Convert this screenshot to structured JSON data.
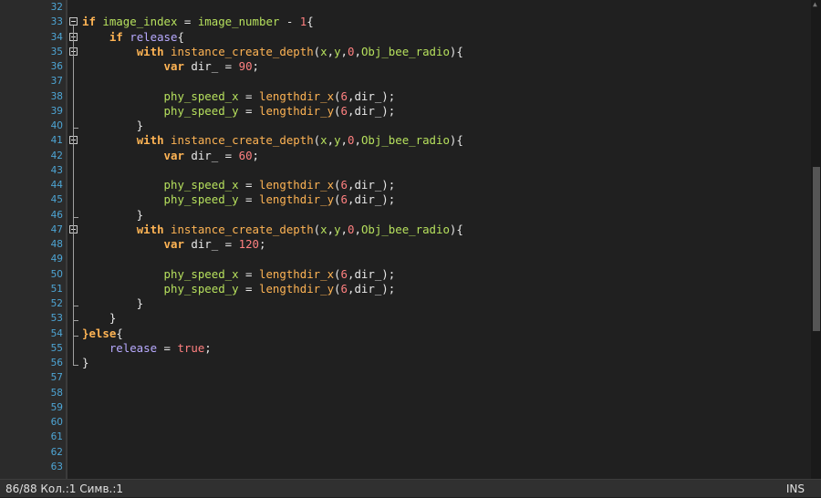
{
  "editor": {
    "line_numbers": [
      "32",
      "33",
      "34",
      "35",
      "36",
      "37",
      "38",
      "39",
      "40",
      "41",
      "42",
      "43",
      "44",
      "45",
      "46",
      "47",
      "48",
      "49",
      "50",
      "51",
      "52",
      "53",
      "54",
      "55",
      "56",
      "57",
      "58",
      "59",
      "60",
      "61",
      "62",
      "63"
    ],
    "lines": [
      {
        "no": "32",
        "tokens": []
      },
      {
        "no": "33",
        "tokens": [
          [
            "kw",
            "if"
          ],
          [
            "op",
            " "
          ],
          [
            "lf",
            "image_index"
          ],
          [
            "op",
            " = "
          ],
          [
            "lf",
            "image_number"
          ],
          [
            "op",
            " - "
          ],
          [
            "num",
            "1"
          ],
          [
            "op",
            "{"
          ]
        ]
      },
      {
        "no": "34",
        "tokens": [
          [
            "op",
            "    "
          ],
          [
            "kw",
            "if"
          ],
          [
            "op",
            " "
          ],
          [
            "var",
            "release"
          ],
          [
            "op",
            "{"
          ]
        ]
      },
      {
        "no": "35",
        "tokens": [
          [
            "op",
            "        "
          ],
          [
            "kw",
            "with"
          ],
          [
            "op",
            " "
          ],
          [
            "fn",
            "instance_create_depth"
          ],
          [
            "op",
            "("
          ],
          [
            "lf",
            "x"
          ],
          [
            "op",
            ","
          ],
          [
            "lf",
            "y"
          ],
          [
            "op",
            ","
          ],
          [
            "num",
            "0"
          ],
          [
            "op",
            ","
          ],
          [
            "lf",
            "Obj_bee_radio"
          ],
          [
            "op",
            ")"
          ],
          [
            "op",
            "{"
          ]
        ]
      },
      {
        "no": "36",
        "tokens": [
          [
            "op",
            "            "
          ],
          [
            "kw",
            "var"
          ],
          [
            "op",
            " dir_ = "
          ],
          [
            "num",
            "90"
          ],
          [
            "op",
            ";"
          ]
        ]
      },
      {
        "no": "37",
        "tokens": []
      },
      {
        "no": "38",
        "tokens": [
          [
            "op",
            "            "
          ],
          [
            "lf",
            "phy_speed_x"
          ],
          [
            "op",
            " = "
          ],
          [
            "fn",
            "lengthdir_x"
          ],
          [
            "op",
            "("
          ],
          [
            "num",
            "6"
          ],
          [
            "op",
            ",dir_);"
          ]
        ]
      },
      {
        "no": "39",
        "tokens": [
          [
            "op",
            "            "
          ],
          [
            "lf",
            "phy_speed_y"
          ],
          [
            "op",
            " = "
          ],
          [
            "fn",
            "lengthdir_y"
          ],
          [
            "op",
            "("
          ],
          [
            "num",
            "6"
          ],
          [
            "op",
            ",dir_);"
          ]
        ]
      },
      {
        "no": "40",
        "tokens": [
          [
            "op",
            "        }"
          ]
        ]
      },
      {
        "no": "41",
        "tokens": [
          [
            "op",
            "        "
          ],
          [
            "kw",
            "with"
          ],
          [
            "op",
            " "
          ],
          [
            "fn",
            "instance_create_depth"
          ],
          [
            "op",
            "("
          ],
          [
            "lf",
            "x"
          ],
          [
            "op",
            ","
          ],
          [
            "lf",
            "y"
          ],
          [
            "op",
            ","
          ],
          [
            "num",
            "0"
          ],
          [
            "op",
            ","
          ],
          [
            "lf",
            "Obj_bee_radio"
          ],
          [
            "op",
            ")"
          ],
          [
            "op",
            "{"
          ]
        ]
      },
      {
        "no": "42",
        "tokens": [
          [
            "op",
            "            "
          ],
          [
            "kw",
            "var"
          ],
          [
            "op",
            " dir_ = "
          ],
          [
            "num",
            "60"
          ],
          [
            "op",
            ";"
          ]
        ]
      },
      {
        "no": "43",
        "tokens": []
      },
      {
        "no": "44",
        "tokens": [
          [
            "op",
            "            "
          ],
          [
            "lf",
            "phy_speed_x"
          ],
          [
            "op",
            " = "
          ],
          [
            "fn",
            "lengthdir_x"
          ],
          [
            "op",
            "("
          ],
          [
            "num",
            "6"
          ],
          [
            "op",
            ",dir_);"
          ]
        ]
      },
      {
        "no": "45",
        "tokens": [
          [
            "op",
            "            "
          ],
          [
            "lf",
            "phy_speed_y"
          ],
          [
            "op",
            " = "
          ],
          [
            "fn",
            "lengthdir_y"
          ],
          [
            "op",
            "("
          ],
          [
            "num",
            "6"
          ],
          [
            "op",
            ",dir_);"
          ]
        ]
      },
      {
        "no": "46",
        "tokens": [
          [
            "op",
            "        }"
          ]
        ]
      },
      {
        "no": "47",
        "tokens": [
          [
            "op",
            "        "
          ],
          [
            "kw",
            "with"
          ],
          [
            "op",
            " "
          ],
          [
            "fn",
            "instance_create_depth"
          ],
          [
            "op",
            "("
          ],
          [
            "lf",
            "x"
          ],
          [
            "op",
            ","
          ],
          [
            "lf",
            "y"
          ],
          [
            "op",
            ","
          ],
          [
            "num",
            "0"
          ],
          [
            "op",
            ","
          ],
          [
            "lf",
            "Obj_bee_radio"
          ],
          [
            "op",
            ")"
          ],
          [
            "op",
            "{"
          ]
        ]
      },
      {
        "no": "48",
        "tokens": [
          [
            "op",
            "            "
          ],
          [
            "kw",
            "var"
          ],
          [
            "op",
            " dir_ = "
          ],
          [
            "num",
            "120"
          ],
          [
            "op",
            ";"
          ]
        ]
      },
      {
        "no": "49",
        "tokens": []
      },
      {
        "no": "50",
        "tokens": [
          [
            "op",
            "            "
          ],
          [
            "lf",
            "phy_speed_x"
          ],
          [
            "op",
            " = "
          ],
          [
            "fn",
            "lengthdir_x"
          ],
          [
            "op",
            "("
          ],
          [
            "num",
            "6"
          ],
          [
            "op",
            ",dir_);"
          ]
        ]
      },
      {
        "no": "51",
        "tokens": [
          [
            "op",
            "            "
          ],
          [
            "lf",
            "phy_speed_y"
          ],
          [
            "op",
            " = "
          ],
          [
            "fn",
            "lengthdir_y"
          ],
          [
            "op",
            "("
          ],
          [
            "num",
            "6"
          ],
          [
            "op",
            ",dir_);"
          ]
        ]
      },
      {
        "no": "52",
        "tokens": [
          [
            "op",
            "        }"
          ]
        ]
      },
      {
        "no": "53",
        "tokens": [
          [
            "op",
            "    }"
          ]
        ]
      },
      {
        "no": "54",
        "tokens": [
          [
            "kw",
            "}else"
          ],
          [
            "op",
            "{"
          ]
        ]
      },
      {
        "no": "55",
        "tokens": [
          [
            "op",
            "    "
          ],
          [
            "var",
            "release"
          ],
          [
            "op",
            " = "
          ],
          [
            "lit",
            "true"
          ],
          [
            "op",
            ";"
          ]
        ]
      },
      {
        "no": "56",
        "tokens": [
          [
            "op",
            "}"
          ]
        ]
      },
      {
        "no": "57",
        "tokens": []
      },
      {
        "no": "58",
        "tokens": []
      },
      {
        "no": "59",
        "tokens": []
      },
      {
        "no": "60",
        "tokens": []
      },
      {
        "no": "61",
        "tokens": []
      },
      {
        "no": "62",
        "tokens": []
      },
      {
        "no": "63",
        "tokens": []
      }
    ]
  },
  "statusbar": {
    "position": "86/88 Кол.:1 Симв.:1",
    "mode": "INS"
  },
  "colors": {
    "keyword": "#ffb454",
    "local_field": "#b6e05d",
    "number": "#ff8080",
    "instance_var": "#b8aaff",
    "line_number": "#4ea6d6"
  },
  "icons": [
    "fold-toggle-icon",
    "scroll-up-arrow-icon"
  ]
}
